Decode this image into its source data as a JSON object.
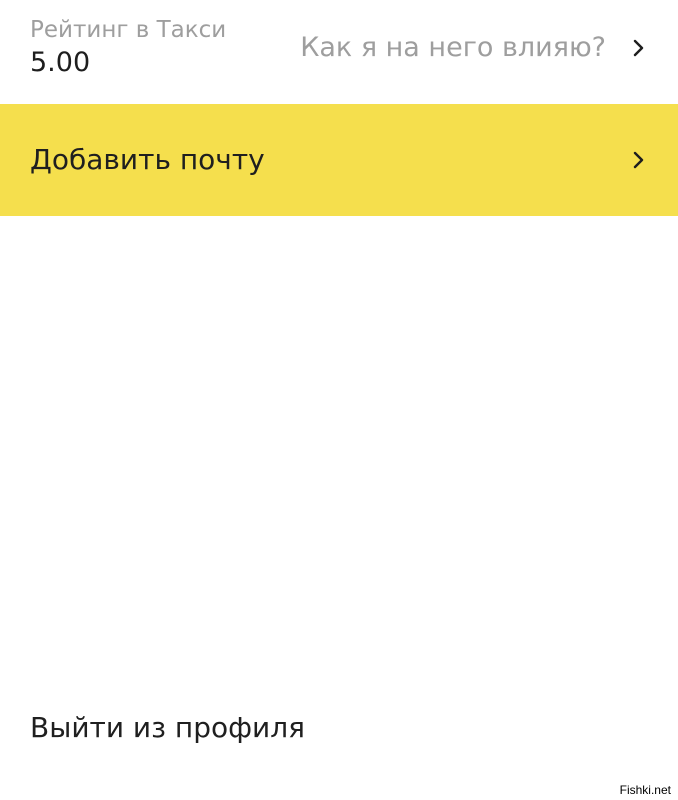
{
  "colors": {
    "accent_yellow": "#f5df4d",
    "muted_text": "#9e9e9e",
    "primary_text": "#1f1f1f",
    "background": "#ffffff"
  },
  "rating": {
    "label": "Рейтинг в Такси",
    "value": "5.00",
    "link_label": "Как я на него влияю?",
    "chevron_icon": "chevron-right-icon"
  },
  "email": {
    "label": "Добавить почту",
    "chevron_icon": "chevron-right-icon"
  },
  "logout": {
    "label": "Выйти из профиля"
  },
  "watermark": {
    "text": "Fishki.net"
  }
}
